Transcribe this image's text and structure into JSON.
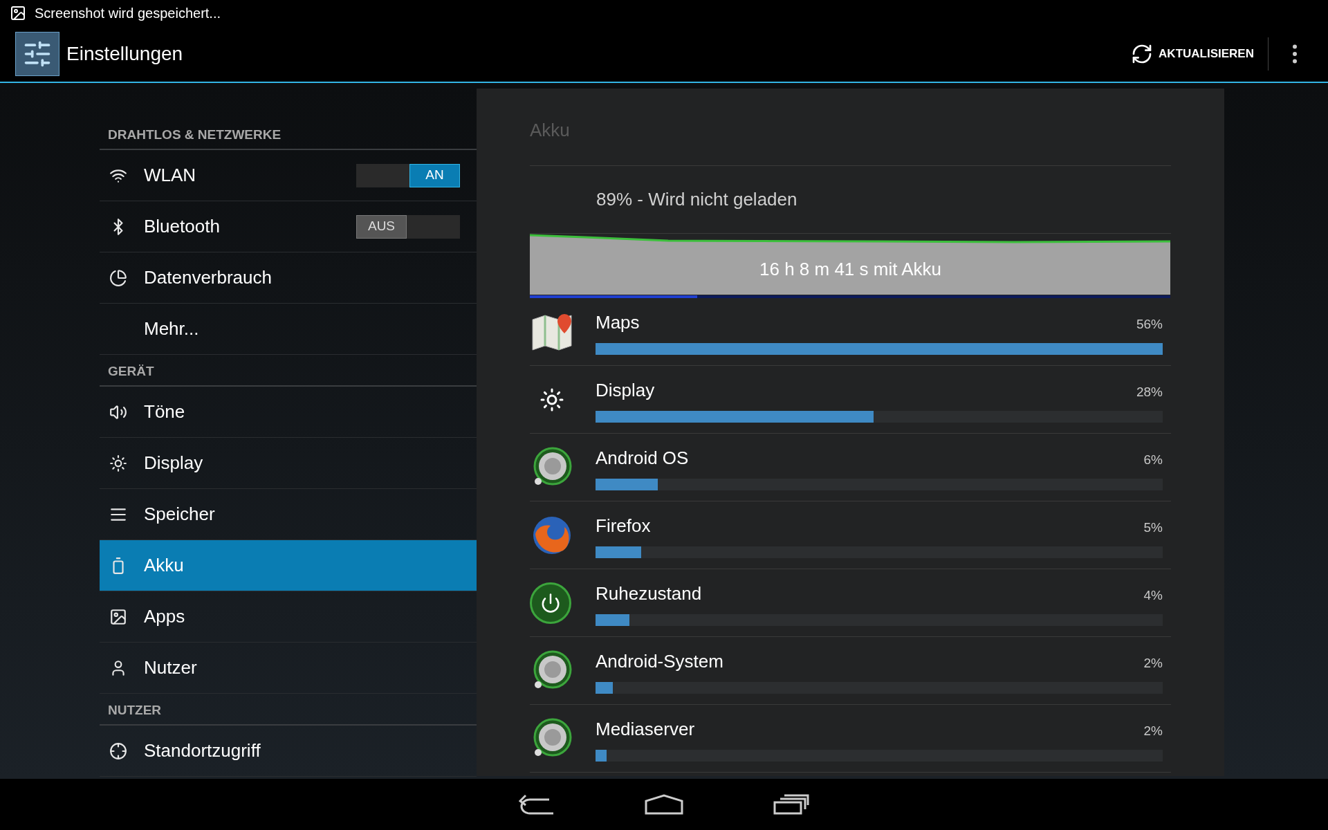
{
  "status_bar": {
    "notification": "Screenshot wird gespeichert..."
  },
  "action_bar": {
    "title": "Einstellungen",
    "action": "AKTUALISIEREN"
  },
  "sidebar": {
    "items": [
      {
        "kind": "header",
        "label": "DRAHTLOS & NETZWERKE"
      },
      {
        "kind": "toggle",
        "label": "WLAN",
        "selected": false,
        "on": true,
        "toggle_label": "AN"
      },
      {
        "kind": "toggle",
        "label": "Bluetooth",
        "selected": false,
        "on": false,
        "toggle_label": "AUS"
      },
      {
        "kind": "item",
        "label": "Datenverbrauch",
        "selected": false
      },
      {
        "kind": "item",
        "label": "Mehr...",
        "selected": false
      },
      {
        "kind": "header",
        "label": "GERÄT"
      },
      {
        "kind": "item",
        "label": "Töne",
        "selected": false
      },
      {
        "kind": "item",
        "label": "Display",
        "selected": false
      },
      {
        "kind": "item",
        "label": "Speicher",
        "selected": false
      },
      {
        "kind": "item",
        "label": "Akku",
        "selected": true
      },
      {
        "kind": "item",
        "label": "Apps",
        "selected": false
      },
      {
        "kind": "item",
        "label": "Nutzer",
        "selected": false
      },
      {
        "kind": "header",
        "label": "NUTZER"
      },
      {
        "kind": "item",
        "label": "Standortzugriff",
        "selected": false
      }
    ]
  },
  "battery": {
    "title": "Akku",
    "status": "89% - Wird nicht geladen",
    "graph_label": "16 h 8 m 41 s mit Akku",
    "usage": [
      {
        "name": "Maps",
        "percent": "56%",
        "level": 1.0
      },
      {
        "name": "Display",
        "percent": "28%",
        "level": 0.49
      },
      {
        "name": "Android OS",
        "percent": "6%",
        "level": 0.11
      },
      {
        "name": "Firefox",
        "percent": "5%",
        "level": 0.08
      },
      {
        "name": "Ruhezustand",
        "percent": "4%",
        "level": 0.06
      },
      {
        "name": "Android-System",
        "percent": "2%",
        "level": 0.03
      },
      {
        "name": "Mediaserver",
        "percent": "2%",
        "level": 0.02
      }
    ]
  }
}
